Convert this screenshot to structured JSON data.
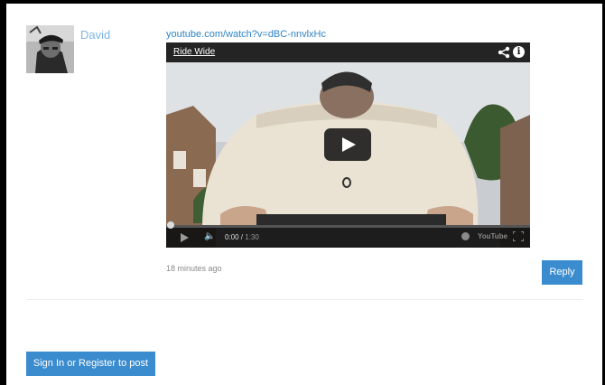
{
  "comment": {
    "author": "David",
    "link_text": "youtube.com/watch?v=dBC-nnvlxHc",
    "timestamp": "18 minutes ago",
    "reply_label": "Reply"
  },
  "video": {
    "title": "Ride Wide",
    "current_time": "0:00",
    "duration": "1:30",
    "progress_fraction": 0,
    "logo_text": "YouTube",
    "icons": [
      "share-icon",
      "info-icon",
      "play-icon",
      "volume-icon",
      "settings-icon",
      "youtube-logo",
      "fullscreen-icon"
    ]
  },
  "footer": {
    "signin_label": "Sign In or Register to post"
  },
  "colors": {
    "link": "#2f84c7",
    "author": "#7fb6e3",
    "button": "#3b8ccf",
    "progress": "#cc181e"
  }
}
